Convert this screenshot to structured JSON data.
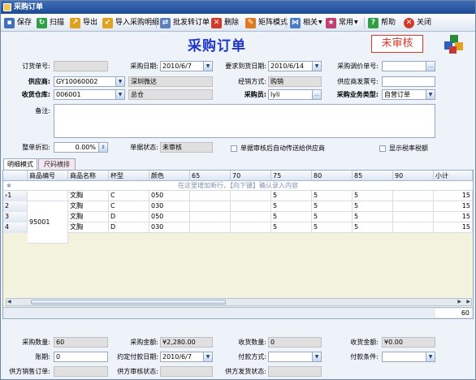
{
  "window": {
    "title": "采购订单"
  },
  "toolbar": {
    "save": "保存",
    "scan": "扫描",
    "export": "导出",
    "import_detail": "导入采购明细",
    "batch_convert": "批发转订单",
    "delete": "删除",
    "matrix_mode": "矩阵模式",
    "related": "相关",
    "common": "常用",
    "help": "帮助",
    "close": "关闭"
  },
  "header": {
    "title": "采购订单",
    "status_stamp": "未审核"
  },
  "form": {
    "order_no": {
      "label": "订货单号:",
      "value": ""
    },
    "purchase_date": {
      "label": "采购日期:",
      "value": "2010/6/7"
    },
    "required_date": {
      "label": "要求到货日期:",
      "value": "2010/6/14"
    },
    "price_adj_no": {
      "label": "采购调价单号:",
      "value": ""
    },
    "supplier": {
      "label": "供应商:",
      "code": "GY10060002",
      "name": "深圳微达"
    },
    "business_type": {
      "label": "经销方式:",
      "value": "购销"
    },
    "supplier_invoice": {
      "label": "供应商发票号:",
      "value": ""
    },
    "warehouse": {
      "label": "收货仓库:",
      "code": "006001",
      "name": "总仓"
    },
    "buyer": {
      "label": "采购员:",
      "value": "lyli"
    },
    "biz_type": {
      "label": "采购业务类型:",
      "value": "自营订单"
    },
    "remarks": {
      "label": "备注:",
      "value": ""
    },
    "discount": {
      "label": "整单折扣:",
      "value": "0.00%"
    },
    "doc_status": {
      "label": "单据状态:",
      "value": "未审核"
    },
    "auto_send": "单据审核后自动传送给供应商",
    "show_tax": "显示税率税额"
  },
  "tabs": [
    "明细模式",
    "尺码横排"
  ],
  "grid": {
    "new_row_hint": "在这里增加新行，【向下键】确认录入内容",
    "columns": [
      "商品编号",
      "商品名称",
      "杯型",
      "颜色",
      "65",
      "70",
      "75",
      "80",
      "85",
      "90",
      "小计"
    ],
    "rows": [
      {
        "num": "1",
        "name": "文胸",
        "cup": "C",
        "color": "050",
        "s65": "",
        "s70": "",
        "s75": "5",
        "s80": "5",
        "s85": "5",
        "s90": "",
        "subtotal": "15"
      },
      {
        "num": "2",
        "name": "文胸",
        "cup": "C",
        "color": "030",
        "s65": "",
        "s70": "",
        "s75": "5",
        "s80": "5",
        "s85": "5",
        "s90": "",
        "subtotal": "15"
      },
      {
        "num": "3",
        "name": "文胸",
        "cup": "D",
        "color": "050",
        "s65": "",
        "s70": "",
        "s75": "5",
        "s80": "5",
        "s85": "5",
        "s90": "",
        "subtotal": "15"
      },
      {
        "num": "4",
        "name": "文胸",
        "cup": "D",
        "color": "030",
        "s65": "",
        "s70": "",
        "s75": "5",
        "s80": "5",
        "s85": "5",
        "s90": "",
        "subtotal": "15"
      }
    ],
    "product_code": "95001",
    "total": "60"
  },
  "footer": {
    "purchase_qty": {
      "label": "采购数量:",
      "value": "60"
    },
    "purchase_amount": {
      "label": "采购金额:",
      "value": "¥2,280.00"
    },
    "received_qty": {
      "label": "收货数量:",
      "value": "0"
    },
    "received_amount": {
      "label": "收货金额:",
      "value": "¥0.00"
    },
    "account_period": {
      "label": "账期:",
      "value": "0"
    },
    "agreed_pay_date": {
      "label": "约定付款日期:",
      "value": "2010/6/7"
    },
    "pay_method": {
      "label": "付款方式:",
      "value": ""
    },
    "pay_terms": {
      "label": "付款条件:",
      "value": ""
    },
    "supplier_sales_order": {
      "label": "供方销售订单:",
      "value": ""
    },
    "supplier_audit_status": {
      "label": "供方审核状态:",
      "value": ""
    },
    "supplier_ship_status": {
      "label": "供方发货状态:",
      "value": ""
    }
  }
}
